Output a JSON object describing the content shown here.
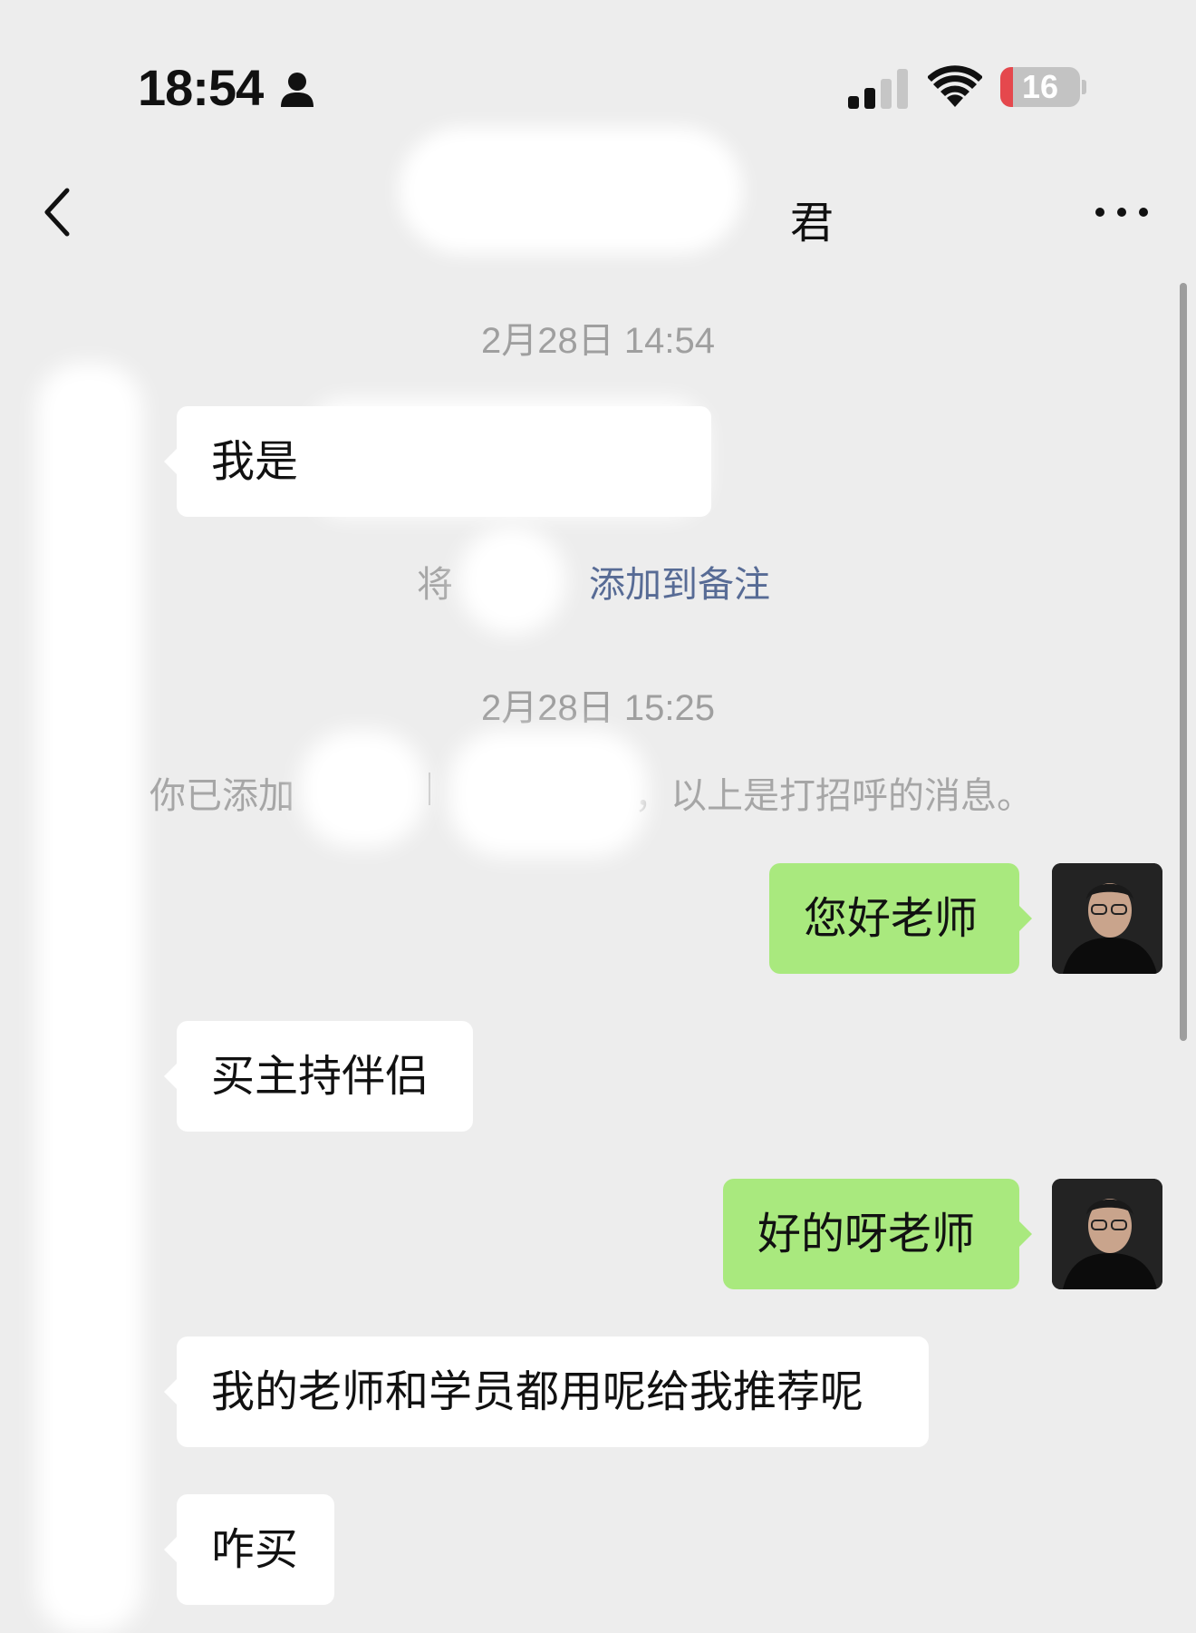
{
  "status_bar": {
    "time": "18:54",
    "battery_level": "16",
    "battery_fraction": 0.16,
    "icons": [
      "person-icon",
      "signal-icon",
      "wifi-icon",
      "battery-icon"
    ]
  },
  "nav": {
    "back_icon": "chevron-left-icon",
    "title_visible": "君",
    "more_icon": "ellipsis-icon"
  },
  "messages": {
    "ts1": "2月28日 14:54",
    "m1": "我是",
    "sys1_prefix": "将",
    "sys1_link": "添加到备注",
    "ts2": "2月28日 15:25",
    "sys2_prefix": "你已添加",
    "sys2_suffix": "，以上是打招呼的消息。",
    "m2": "您好老师",
    "m3": "买主持伴侣",
    "m4": "好的呀老师",
    "m5": "我的老师和学员都用呢给我推荐呢",
    "m6": "咋买"
  },
  "colors": {
    "background": "#ededed",
    "incoming_bubble": "#ffffff",
    "outgoing_bubble": "#a9e97e",
    "link": "#576b95",
    "battery_low": "#e5484d"
  }
}
